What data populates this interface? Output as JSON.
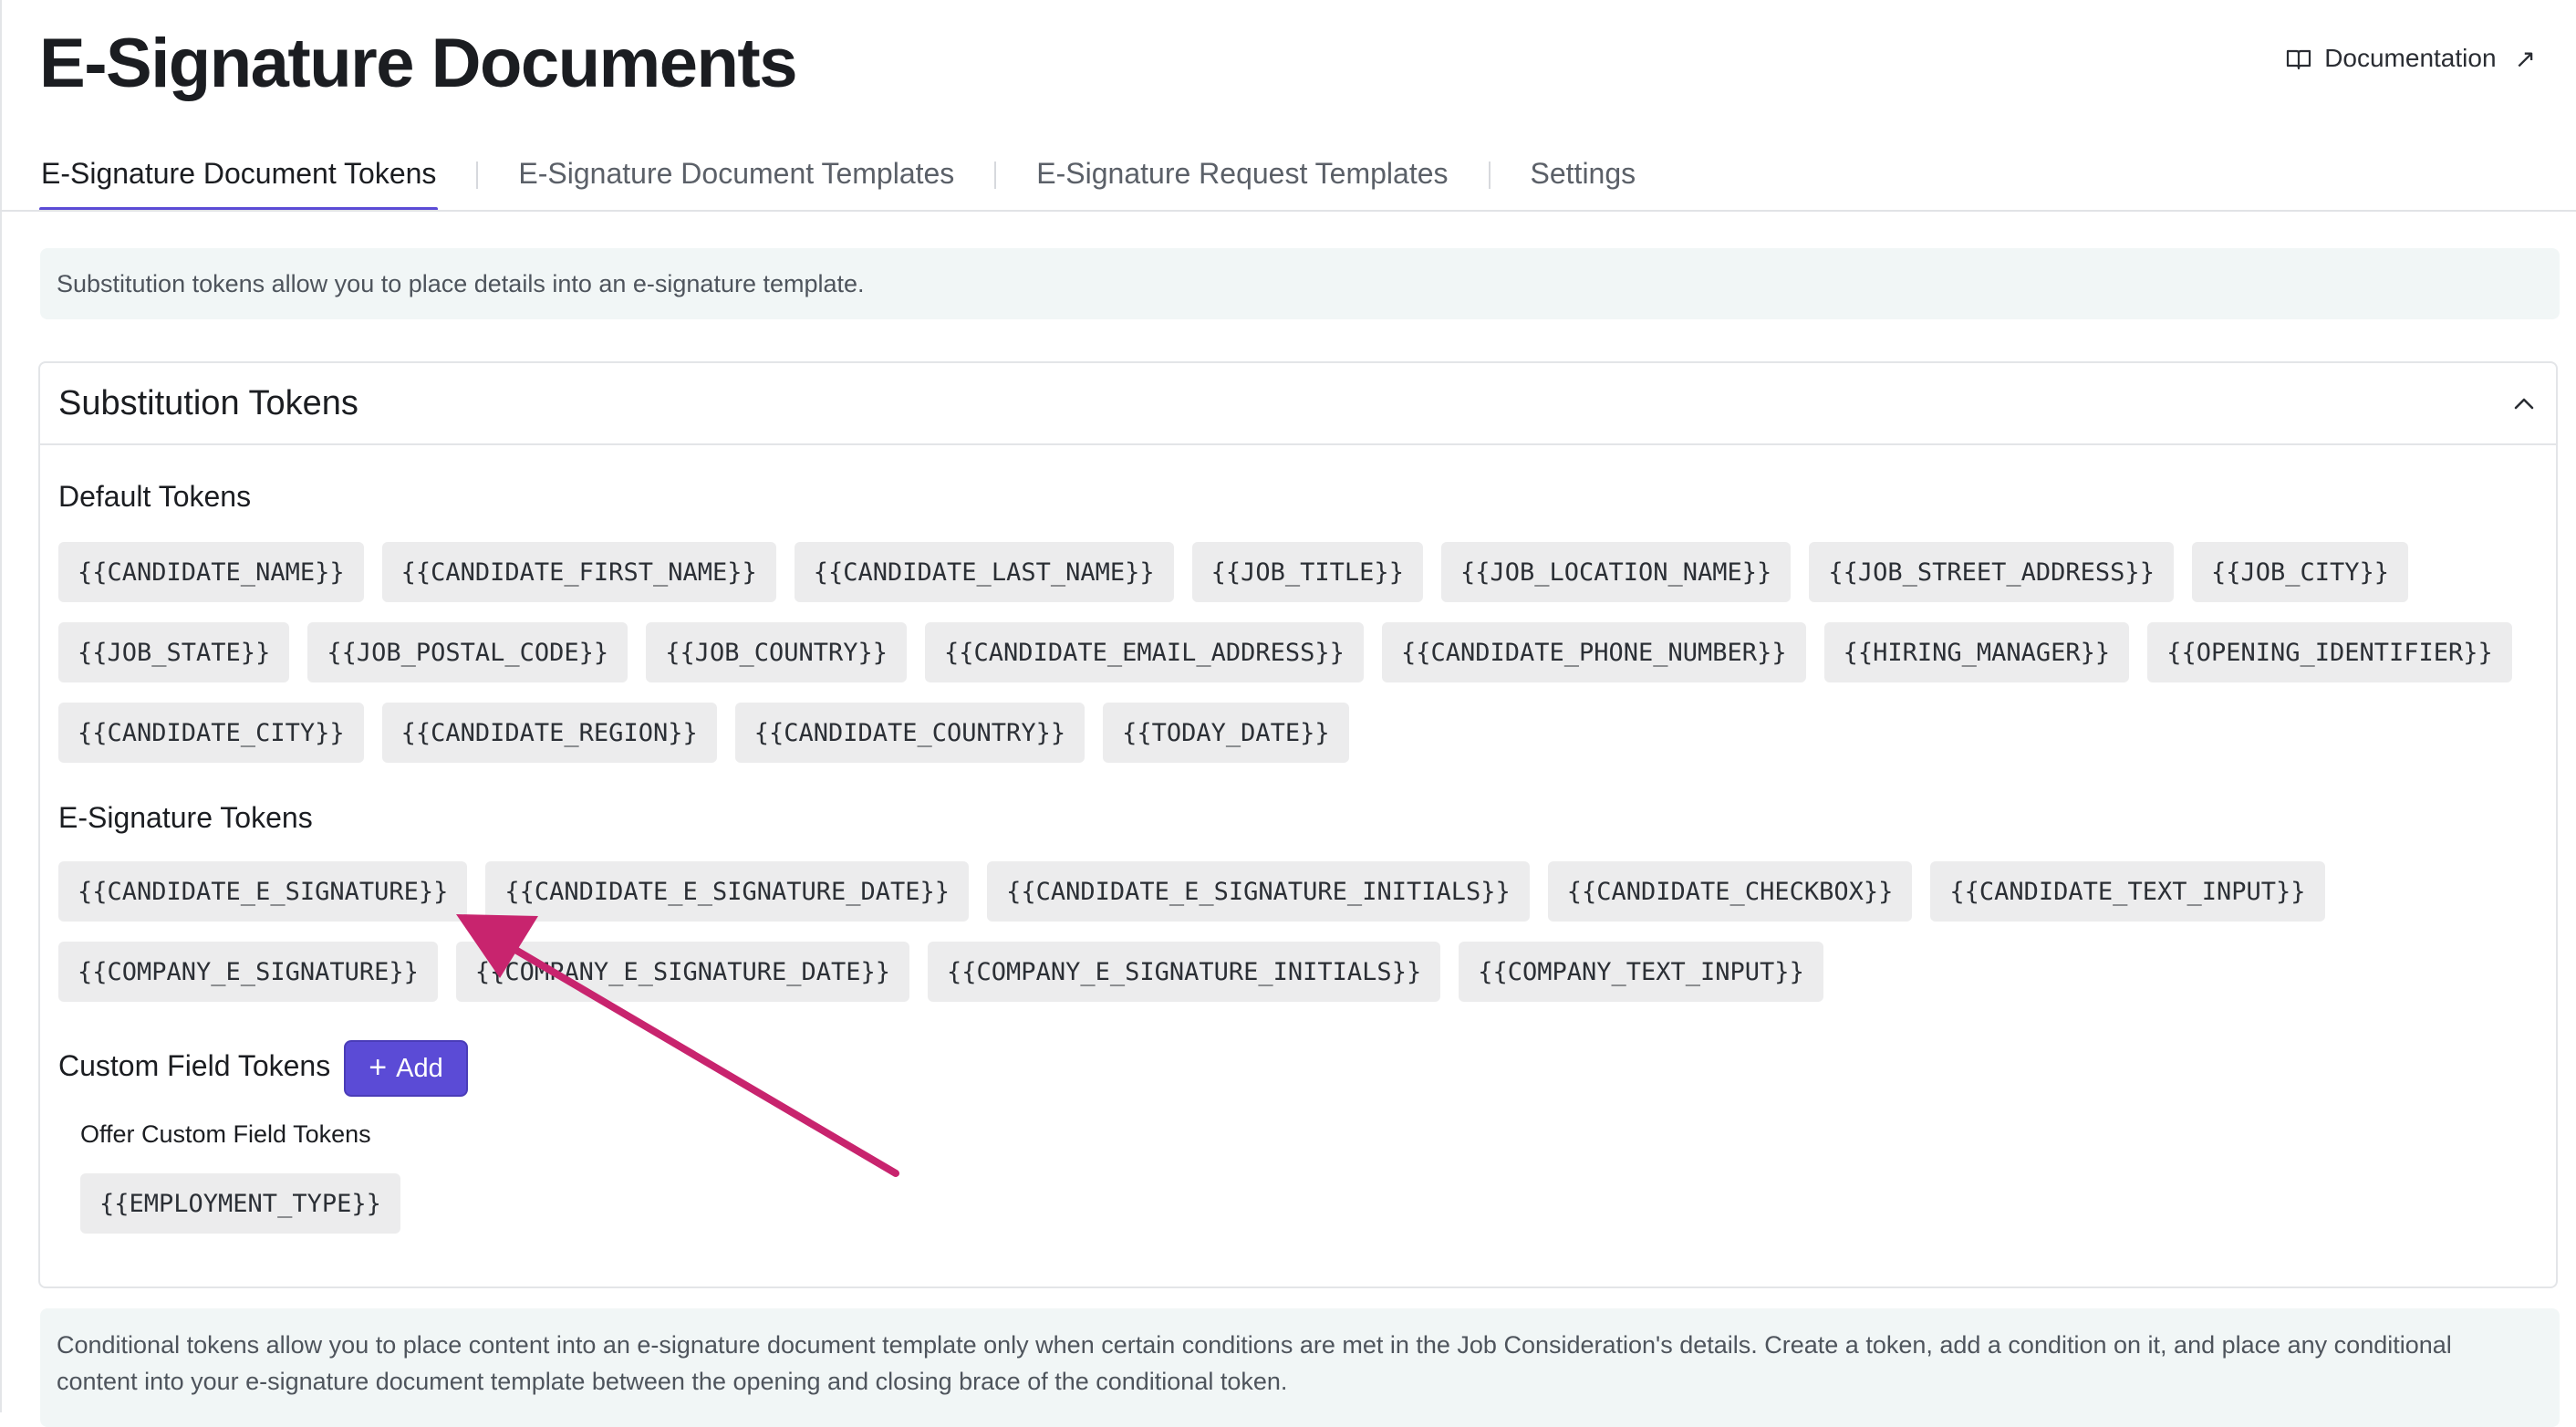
{
  "page": {
    "title": "E-Signature Documents",
    "doc_link": {
      "label": "Documentation",
      "icon": "book-icon",
      "ext_icon": "external-link-icon",
      "ext_glyph": "↗"
    }
  },
  "tabs": [
    {
      "label": "E-Signature Document Tokens",
      "active": true
    },
    {
      "label": "E-Signature Document Templates",
      "active": false
    },
    {
      "label": "E-Signature Request Templates",
      "active": false
    },
    {
      "label": "Settings",
      "active": false
    }
  ],
  "info": {
    "text": "Substitution tokens allow you to place details into an e-signature template."
  },
  "card": {
    "title": "Substitution Tokens",
    "collapse_icon": "chevron-up-icon",
    "default": {
      "title": "Default Tokens",
      "rows": [
        [
          "{{CANDIDATE_NAME}}",
          "{{CANDIDATE_FIRST_NAME}}",
          "{{CANDIDATE_LAST_NAME}}",
          "{{JOB_TITLE}}",
          "{{JOB_LOCATION_NAME}}",
          "{{JOB_STREET_ADDRESS}}",
          "{{JOB_CITY}}"
        ],
        [
          "{{JOB_STATE}}",
          "{{JOB_POSTAL_CODE}}",
          "{{JOB_COUNTRY}}",
          "{{CANDIDATE_EMAIL_ADDRESS}}",
          "{{CANDIDATE_PHONE_NUMBER}}",
          "{{HIRING_MANAGER}}",
          "{{OPENING_IDENTIFIER}}"
        ],
        [
          "{{CANDIDATE_CITY}}",
          "{{CANDIDATE_REGION}}",
          "{{CANDIDATE_COUNTRY}}",
          "{{TODAY_DATE}}"
        ]
      ]
    },
    "esig": {
      "title": "E-Signature Tokens",
      "rows": [
        [
          "{{CANDIDATE_E_SIGNATURE}}",
          "{{CANDIDATE_E_SIGNATURE_DATE}}",
          "{{CANDIDATE_E_SIGNATURE_INITIALS}}",
          "{{CANDIDATE_CHECKBOX}}",
          "{{CANDIDATE_TEXT_INPUT}}"
        ],
        [
          "{{COMPANY_E_SIGNATURE}}",
          "{{COMPANY_E_SIGNATURE_DATE}}",
          "{{COMPANY_E_SIGNATURE_INITIALS}}",
          "{{COMPANY_TEXT_INPUT}}"
        ]
      ]
    },
    "custom": {
      "title": "Custom Field Tokens",
      "add_label": "Add",
      "add_icon": "plus-icon",
      "plus_glyph": "+",
      "offer_title": "Offer Custom Field Tokens",
      "offer_tokens": [
        "{{EMPLOYMENT_TYPE}}"
      ]
    }
  },
  "conditional": {
    "line1": "Conditional tokens allow you to place content into an e-signature document template only when certain conditions are met in the Job Consideration's details. Create a token, add a condition on it, and place any conditional",
    "line2": "content into your e-signature document template between the opening and closing brace of the conditional token."
  },
  "colors": {
    "accent": "#5b4bd6",
    "annotation_arrow": "#c8246e",
    "token_bg": "#ececed",
    "info_bg": "#f1f6f6"
  }
}
